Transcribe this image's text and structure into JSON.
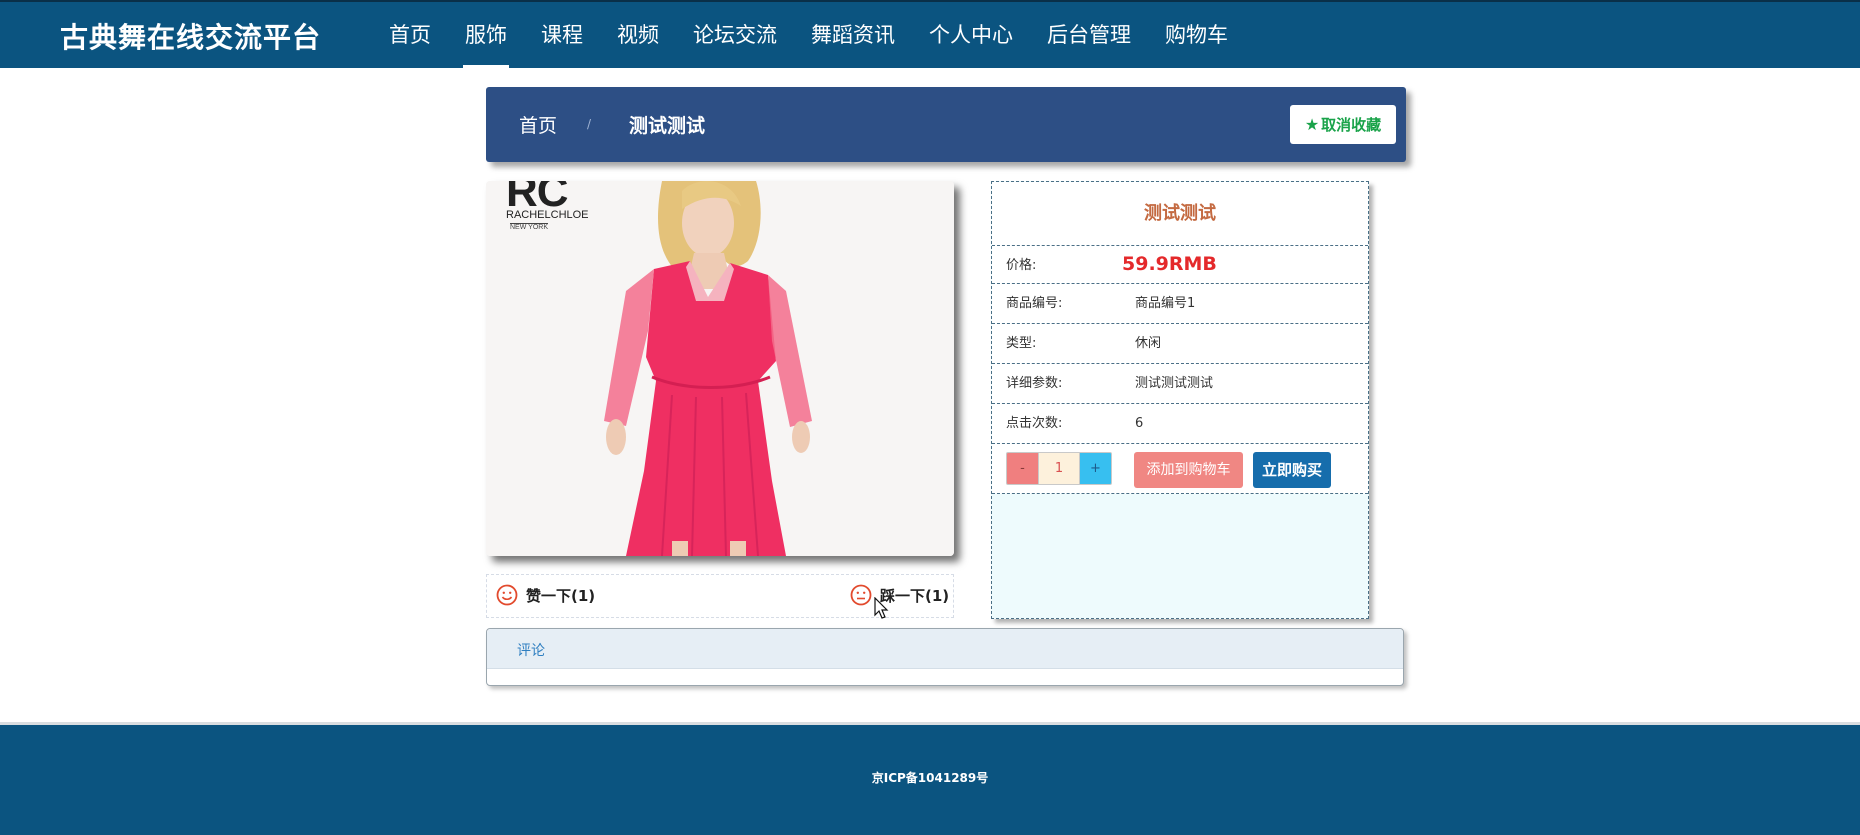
{
  "app": {
    "title": "古典舞在线交流平台"
  },
  "nav": {
    "items": [
      {
        "label": "首页"
      },
      {
        "label": "服饰"
      },
      {
        "label": "课程"
      },
      {
        "label": "视频"
      },
      {
        "label": "论坛交流"
      },
      {
        "label": "舞蹈资讯"
      },
      {
        "label": "个人中心"
      },
      {
        "label": "后台管理"
      },
      {
        "label": "购物车"
      }
    ],
    "active_index": 1
  },
  "breadcrumb": {
    "home": "首页",
    "separator": "/",
    "current": "测试测试"
  },
  "favorite": {
    "label": "取消收藏",
    "icon": "star-icon",
    "color": "#1aa34a"
  },
  "product_image": {
    "alt": "红色连衣裙",
    "logo_mark": "RC",
    "logo_name": "RACHELCHLOE",
    "logo_city": "NEW YORK"
  },
  "votes": {
    "like": {
      "label": "赞一下(1)",
      "icon": "smile-icon"
    },
    "dislike": {
      "label": "踩一下(1)",
      "icon": "neutral-face-icon"
    }
  },
  "product": {
    "name": "测试测试",
    "price_label": "价格:",
    "price_value": "59.9RMB",
    "rows": [
      {
        "label": "商品编号:",
        "value": "商品编号1"
      },
      {
        "label": "类型:",
        "value": "休闲"
      },
      {
        "label": "详细参数:",
        "value": "测试测试测试"
      },
      {
        "label": "点击次数:",
        "value": "6"
      }
    ],
    "quantity": {
      "minus": "-",
      "value": "1",
      "plus": "+"
    },
    "add_to_cart": "添加到购物车",
    "buy_now": "立即购买"
  },
  "comments": {
    "tab": "评论"
  },
  "footer": {
    "icp": "京ICP备1041289号"
  },
  "colors": {
    "nav_bg": "#0b5480",
    "crumb_bg": "#2d4f85",
    "price": "#e4292b",
    "title_accent": "#c46a41",
    "buy_button": "#166dac",
    "cart_button": "#f08783"
  }
}
